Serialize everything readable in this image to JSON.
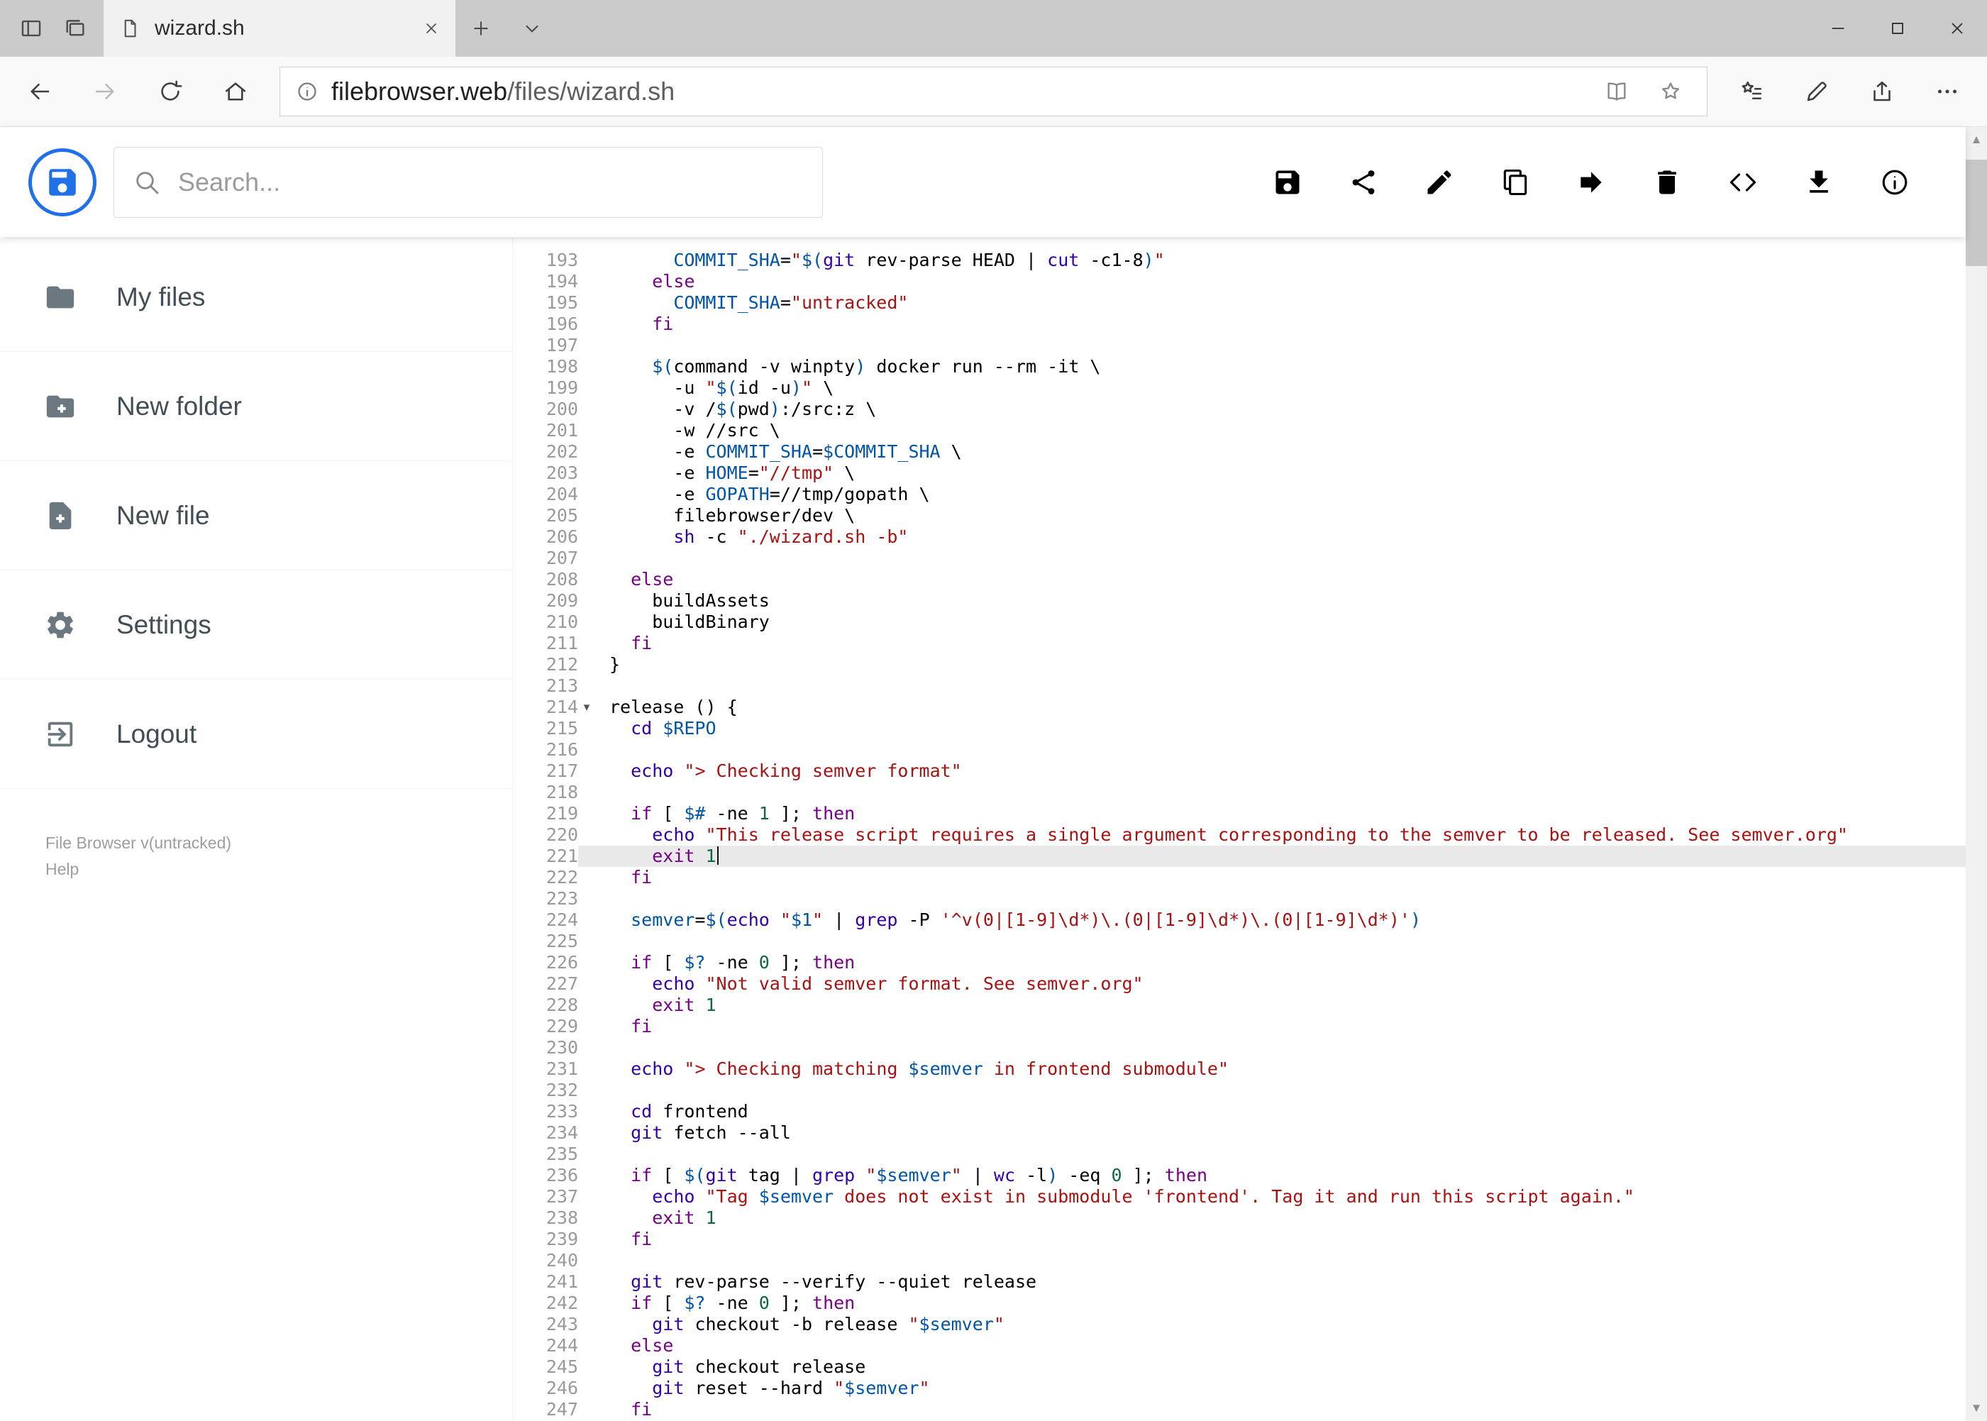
{
  "browser": {
    "tab_title": "wizard.sh",
    "url_domain": "filebrowser.web",
    "url_path": "/files/wizard.sh"
  },
  "header": {
    "search_placeholder": "Search...",
    "actions": [
      {
        "id": "save",
        "icon": "save"
      },
      {
        "id": "share",
        "icon": "share3"
      },
      {
        "id": "rename",
        "icon": "pencil"
      },
      {
        "id": "copy",
        "icon": "copy"
      },
      {
        "id": "move",
        "icon": "forward"
      },
      {
        "id": "delete",
        "icon": "trash"
      },
      {
        "id": "source",
        "icon": "code"
      },
      {
        "id": "download",
        "icon": "download"
      },
      {
        "id": "info",
        "icon": "info"
      }
    ]
  },
  "sidebar": {
    "items": [
      {
        "id": "my-files",
        "icon": "folder",
        "label": "My files"
      },
      {
        "id": "new-folder",
        "icon": "folder-plus",
        "label": "New folder"
      },
      {
        "id": "new-file",
        "icon": "file-plus",
        "label": "New file"
      },
      {
        "id": "settings",
        "icon": "gear",
        "label": "Settings"
      },
      {
        "id": "logout",
        "icon": "logout",
        "label": "Logout"
      }
    ],
    "footer": {
      "version": "File Browser v(untracked)",
      "help": "Help"
    }
  },
  "colors": {
    "accent": "#2170ea",
    "active_line": "#e9e9e9",
    "syntax_keyword": "#770088",
    "syntax_builtin": "#3300aa",
    "syntax_string": "#aa1111",
    "syntax_variable": "#0055aa",
    "syntax_number": "#116644"
  },
  "editor": {
    "active_line": 221,
    "fold_marker_line": 214,
    "lines": [
      {
        "n": 193,
        "t": [
          [
            "p",
            "      "
          ],
          [
            "v",
            "COMMIT_SHA"
          ],
          [
            "p",
            "="
          ],
          [
            "s",
            "\""
          ],
          [
            "v",
            "$("
          ],
          [
            "b",
            "git"
          ],
          [
            "p",
            " rev-parse HEAD | "
          ],
          [
            "b",
            "cut"
          ],
          [
            "p",
            " -c1-8"
          ],
          [
            "v",
            ")"
          ],
          [
            "s",
            "\""
          ]
        ]
      },
      {
        "n": 194,
        "t": [
          [
            "p",
            "    "
          ],
          [
            "k",
            "else"
          ]
        ]
      },
      {
        "n": 195,
        "t": [
          [
            "p",
            "      "
          ],
          [
            "v",
            "COMMIT_SHA"
          ],
          [
            "p",
            "="
          ],
          [
            "s",
            "\"untracked\""
          ]
        ]
      },
      {
        "n": 196,
        "t": [
          [
            "p",
            "    "
          ],
          [
            "k",
            "fi"
          ]
        ]
      },
      {
        "n": 197,
        "t": []
      },
      {
        "n": 198,
        "t": [
          [
            "p",
            "    "
          ],
          [
            "v",
            "$("
          ],
          [
            "p",
            "command -v winpty"
          ],
          [
            "v",
            ")"
          ],
          [
            "p",
            " docker run --rm -it \\"
          ]
        ]
      },
      {
        "n": 199,
        "t": [
          [
            "p",
            "      -u "
          ],
          [
            "s",
            "\""
          ],
          [
            "v",
            "$("
          ],
          [
            "p",
            "id -u"
          ],
          [
            "v",
            ")"
          ],
          [
            "s",
            "\""
          ],
          [
            "p",
            " \\"
          ]
        ]
      },
      {
        "n": 200,
        "t": [
          [
            "p",
            "      -v /"
          ],
          [
            "v",
            "$("
          ],
          [
            "p",
            "pwd"
          ],
          [
            "v",
            ")"
          ],
          [
            "p",
            ":/src:z \\"
          ]
        ]
      },
      {
        "n": 201,
        "t": [
          [
            "p",
            "      -w //src \\"
          ]
        ]
      },
      {
        "n": 202,
        "t": [
          [
            "p",
            "      -e "
          ],
          [
            "v",
            "COMMIT_SHA"
          ],
          [
            "p",
            "="
          ],
          [
            "v",
            "$COMMIT_SHA"
          ],
          [
            "p",
            " \\"
          ]
        ]
      },
      {
        "n": 203,
        "t": [
          [
            "p",
            "      -e "
          ],
          [
            "v",
            "HOME"
          ],
          [
            "p",
            "="
          ],
          [
            "s",
            "\"//tmp\""
          ],
          [
            "p",
            " \\"
          ]
        ]
      },
      {
        "n": 204,
        "t": [
          [
            "p",
            "      -e "
          ],
          [
            "v",
            "GOPATH"
          ],
          [
            "p",
            "=//tmp/gopath \\"
          ]
        ]
      },
      {
        "n": 205,
        "t": [
          [
            "p",
            "      filebrowser/dev \\"
          ]
        ]
      },
      {
        "n": 206,
        "t": [
          [
            "p",
            "      "
          ],
          [
            "b",
            "sh"
          ],
          [
            "p",
            " -c "
          ],
          [
            "s",
            "\"./wizard.sh -b\""
          ]
        ]
      },
      {
        "n": 207,
        "t": []
      },
      {
        "n": 208,
        "t": [
          [
            "p",
            "  "
          ],
          [
            "k",
            "else"
          ]
        ]
      },
      {
        "n": 209,
        "t": [
          [
            "p",
            "    buildAssets"
          ]
        ]
      },
      {
        "n": 210,
        "t": [
          [
            "p",
            "    buildBinary"
          ]
        ]
      },
      {
        "n": 211,
        "t": [
          [
            "p",
            "  "
          ],
          [
            "k",
            "fi"
          ]
        ]
      },
      {
        "n": 212,
        "t": [
          [
            "p",
            "}"
          ]
        ]
      },
      {
        "n": 213,
        "t": []
      },
      {
        "n": 214,
        "t": [
          [
            "p",
            "release () {"
          ]
        ]
      },
      {
        "n": 215,
        "t": [
          [
            "p",
            "  "
          ],
          [
            "b",
            "cd"
          ],
          [
            "p",
            " "
          ],
          [
            "v",
            "$REPO"
          ]
        ]
      },
      {
        "n": 216,
        "t": []
      },
      {
        "n": 217,
        "t": [
          [
            "p",
            "  "
          ],
          [
            "b",
            "echo"
          ],
          [
            "p",
            " "
          ],
          [
            "s",
            "\"> Checking semver format\""
          ]
        ]
      },
      {
        "n": 218,
        "t": []
      },
      {
        "n": 219,
        "t": [
          [
            "p",
            "  "
          ],
          [
            "k",
            "if"
          ],
          [
            "p",
            " [ "
          ],
          [
            "v",
            "$#"
          ],
          [
            "p",
            " -ne "
          ],
          [
            "n",
            "1"
          ],
          [
            "p",
            " ]; "
          ],
          [
            "k",
            "then"
          ]
        ]
      },
      {
        "n": 220,
        "t": [
          [
            "p",
            "    "
          ],
          [
            "b",
            "echo"
          ],
          [
            "p",
            " "
          ],
          [
            "s",
            "\"This release script requires a single argument corresponding to the semver to be released. See semver.org\""
          ]
        ]
      },
      {
        "n": 221,
        "t": [
          [
            "p",
            "    "
          ],
          [
            "k",
            "exit"
          ],
          [
            "p",
            " "
          ],
          [
            "n",
            "1"
          ]
        ]
      },
      {
        "n": 222,
        "t": [
          [
            "p",
            "  "
          ],
          [
            "k",
            "fi"
          ]
        ]
      },
      {
        "n": 223,
        "t": []
      },
      {
        "n": 224,
        "t": [
          [
            "p",
            "  "
          ],
          [
            "v",
            "semver"
          ],
          [
            "p",
            "="
          ],
          [
            "v",
            "$("
          ],
          [
            "b",
            "echo"
          ],
          [
            "p",
            " "
          ],
          [
            "s",
            "\""
          ],
          [
            "v",
            "$1"
          ],
          [
            "s",
            "\""
          ],
          [
            "p",
            " | "
          ],
          [
            "b",
            "grep"
          ],
          [
            "p",
            " -P "
          ],
          [
            "s",
            "'^v(0|[1-9]\\d*)\\.(0|[1-9]\\d*)\\.(0|[1-9]\\d*)'"
          ],
          [
            "v",
            ")"
          ]
        ]
      },
      {
        "n": 225,
        "t": []
      },
      {
        "n": 226,
        "t": [
          [
            "p",
            "  "
          ],
          [
            "k",
            "if"
          ],
          [
            "p",
            " [ "
          ],
          [
            "v",
            "$?"
          ],
          [
            "p",
            " -ne "
          ],
          [
            "n",
            "0"
          ],
          [
            "p",
            " ]; "
          ],
          [
            "k",
            "then"
          ]
        ]
      },
      {
        "n": 227,
        "t": [
          [
            "p",
            "    "
          ],
          [
            "b",
            "echo"
          ],
          [
            "p",
            " "
          ],
          [
            "s",
            "\"Not valid semver format. See semver.org\""
          ]
        ]
      },
      {
        "n": 228,
        "t": [
          [
            "p",
            "    "
          ],
          [
            "k",
            "exit"
          ],
          [
            "p",
            " "
          ],
          [
            "n",
            "1"
          ]
        ]
      },
      {
        "n": 229,
        "t": [
          [
            "p",
            "  "
          ],
          [
            "k",
            "fi"
          ]
        ]
      },
      {
        "n": 230,
        "t": []
      },
      {
        "n": 231,
        "t": [
          [
            "p",
            "  "
          ],
          [
            "b",
            "echo"
          ],
          [
            "p",
            " "
          ],
          [
            "s",
            "\"> Checking matching "
          ],
          [
            "v",
            "$semver"
          ],
          [
            "s",
            " in frontend submodule\""
          ]
        ]
      },
      {
        "n": 232,
        "t": []
      },
      {
        "n": 233,
        "t": [
          [
            "p",
            "  "
          ],
          [
            "b",
            "cd"
          ],
          [
            "p",
            " frontend"
          ]
        ]
      },
      {
        "n": 234,
        "t": [
          [
            "p",
            "  "
          ],
          [
            "b",
            "git"
          ],
          [
            "p",
            " fetch --all"
          ]
        ]
      },
      {
        "n": 235,
        "t": []
      },
      {
        "n": 236,
        "t": [
          [
            "p",
            "  "
          ],
          [
            "k",
            "if"
          ],
          [
            "p",
            " [ "
          ],
          [
            "v",
            "$("
          ],
          [
            "b",
            "git"
          ],
          [
            "p",
            " tag | "
          ],
          [
            "b",
            "grep"
          ],
          [
            "p",
            " "
          ],
          [
            "s",
            "\""
          ],
          [
            "v",
            "$semver"
          ],
          [
            "s",
            "\""
          ],
          [
            "p",
            " | "
          ],
          [
            "b",
            "wc"
          ],
          [
            "p",
            " -l"
          ],
          [
            "v",
            ")"
          ],
          [
            "p",
            " -eq "
          ],
          [
            "n",
            "0"
          ],
          [
            "p",
            " ]; "
          ],
          [
            "k",
            "then"
          ]
        ]
      },
      {
        "n": 237,
        "t": [
          [
            "p",
            "    "
          ],
          [
            "b",
            "echo"
          ],
          [
            "p",
            " "
          ],
          [
            "s",
            "\"Tag "
          ],
          [
            "v",
            "$semver"
          ],
          [
            "s",
            " does not exist in submodule 'frontend'. Tag it and run this script again.\""
          ]
        ]
      },
      {
        "n": 238,
        "t": [
          [
            "p",
            "    "
          ],
          [
            "k",
            "exit"
          ],
          [
            "p",
            " "
          ],
          [
            "n",
            "1"
          ]
        ]
      },
      {
        "n": 239,
        "t": [
          [
            "p",
            "  "
          ],
          [
            "k",
            "fi"
          ]
        ]
      },
      {
        "n": 240,
        "t": []
      },
      {
        "n": 241,
        "t": [
          [
            "p",
            "  "
          ],
          [
            "b",
            "git"
          ],
          [
            "p",
            " rev-parse --verify --quiet release"
          ]
        ]
      },
      {
        "n": 242,
        "t": [
          [
            "p",
            "  "
          ],
          [
            "k",
            "if"
          ],
          [
            "p",
            " [ "
          ],
          [
            "v",
            "$?"
          ],
          [
            "p",
            " -ne "
          ],
          [
            "n",
            "0"
          ],
          [
            "p",
            " ]; "
          ],
          [
            "k",
            "then"
          ]
        ]
      },
      {
        "n": 243,
        "t": [
          [
            "p",
            "    "
          ],
          [
            "b",
            "git"
          ],
          [
            "p",
            " checkout -b release "
          ],
          [
            "s",
            "\""
          ],
          [
            "v",
            "$semver"
          ],
          [
            "s",
            "\""
          ]
        ]
      },
      {
        "n": 244,
        "t": [
          [
            "p",
            "  "
          ],
          [
            "k",
            "else"
          ]
        ]
      },
      {
        "n": 245,
        "t": [
          [
            "p",
            "    "
          ],
          [
            "b",
            "git"
          ],
          [
            "p",
            " checkout release"
          ]
        ]
      },
      {
        "n": 246,
        "t": [
          [
            "p",
            "    "
          ],
          [
            "b",
            "git"
          ],
          [
            "p",
            " reset --hard "
          ],
          [
            "s",
            "\""
          ],
          [
            "v",
            "$semver"
          ],
          [
            "s",
            "\""
          ]
        ]
      },
      {
        "n": 247,
        "t": [
          [
            "p",
            "  "
          ],
          [
            "k",
            "fi"
          ]
        ]
      }
    ]
  }
}
